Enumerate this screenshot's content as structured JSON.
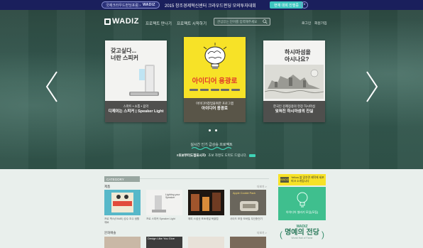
{
  "topbar": {
    "pill_text": "국제크라우드펀딩포럼 ›",
    "pill_brand": "WADIZ",
    "center_text": "2015 창조경제혁신센터 크라우드펀딩 모의투자대회",
    "cta": "현재 대회 진행중",
    "close_icon": "close-icon"
  },
  "nav": {
    "logo": "WADIZ",
    "link1": "프로젝트 만나기",
    "link2": "프로젝트 시작하기",
    "search_placeholder": "관심있는 단어를 입력해주세요",
    "login": "로그인",
    "signup": "회원가입"
  },
  "hero": {
    "cards": [
      {
        "headline": "갖고싶다...\n너란 스피커",
        "caption_small": "스마트 • 소통 • 음악",
        "caption_title": "디제이는 스피커 | Speaker Light"
      },
      {
        "headline": "아이디어 용광로",
        "caption_small": "아이디어창업을위한 프로그램",
        "caption_title": "아이디어 용광로"
      },
      {
        "headline": "하시마섬을\n아시나요?",
        "caption_small": "한국인 강제징용의 현장 하시마섬",
        "caption_title": "잊혀진 하시마섬의 진실"
      }
    ],
    "live_label": "실시간 인기 급상승 프로젝트",
    "ticker_highlight": "#초보부터도점표시지!",
    "ticker_text": "초보 자영도 도미도 드립니다."
  },
  "lower": {
    "category_tab": "CATEGORY",
    "section1": "제품",
    "section1_more": "더보기 >",
    "thumb_captions": [
      "프로 맥스(FAME) 성수 조수 생활재료",
      "프로 스피커 Speaker Light",
      "해피 스냅샷 포토레일 북클럽",
      "사이드 포장 모바일 무선충전기"
    ],
    "thumb2_text": "Lighting your Speaker",
    "thumb4_text": "Apple Cookie Pack",
    "section2": "문화예술",
    "section2_more": "더보기 >",
    "row2_text": "Design Like You Give",
    "ad_box": "WADIZ",
    "ad_text": "Yellow 블 맞추면 제작에 세포피크 소개됩니다",
    "ad2_caption": "아이디어 셀러기 모임(모집)",
    "hall_wadiz": "WADIZ",
    "hall_title": "명예의 전당",
    "hall_sub": "World Hall of Fame"
  },
  "colors": {
    "topbar_bg": "#1a1f5c",
    "hero_bg": "#2d4a42",
    "accent_teal": "#3ec6c0",
    "yellow_card": "#f7e227",
    "lower_bg": "#e9efec"
  }
}
